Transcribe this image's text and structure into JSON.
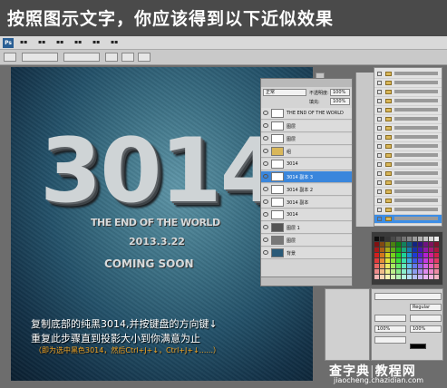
{
  "header": {
    "title": "按照图示文字，你应该得到以下近似效果"
  },
  "app": {
    "logo": "Ps"
  },
  "canvas": {
    "big_text": "3014",
    "line1": "THE END OF THE WORLD",
    "line2": "2013.3.22",
    "line3": "COMING SOON"
  },
  "instructions": {
    "line1": "复制底部的纯黑3014,并按键盘的方向键↓",
    "line2": "重复此步骤直到投影大小到你满意为止",
    "line3": "（即为选中黑色3014，然后Ctrl+J+↓，Ctrl+J+↓......）"
  },
  "layers": {
    "blend_mode": "正常",
    "opacity_label": "不透明度:",
    "opacity_value": "100%",
    "fill_label": "填充:",
    "fill_value": "100%",
    "rows": [
      {
        "name": "THE END OF THE WORLD"
      },
      {
        "name": "图层"
      },
      {
        "name": "图层"
      },
      {
        "name": "组"
      },
      {
        "name": "3014"
      },
      {
        "name": "3014 副本 3"
      },
      {
        "name": "3014 副本 2"
      },
      {
        "name": "3014 副本"
      },
      {
        "name": "3014"
      },
      {
        "name": "图层 1"
      },
      {
        "name": "图层"
      },
      {
        "name": "背景"
      }
    ]
  },
  "character": {
    "font_size": "Regular",
    "tracking": "100%",
    "scale": "100%"
  },
  "watermark": {
    "site": "查字典",
    "site2": "教程网",
    "url": "jiaocheng.chazidian.com"
  }
}
